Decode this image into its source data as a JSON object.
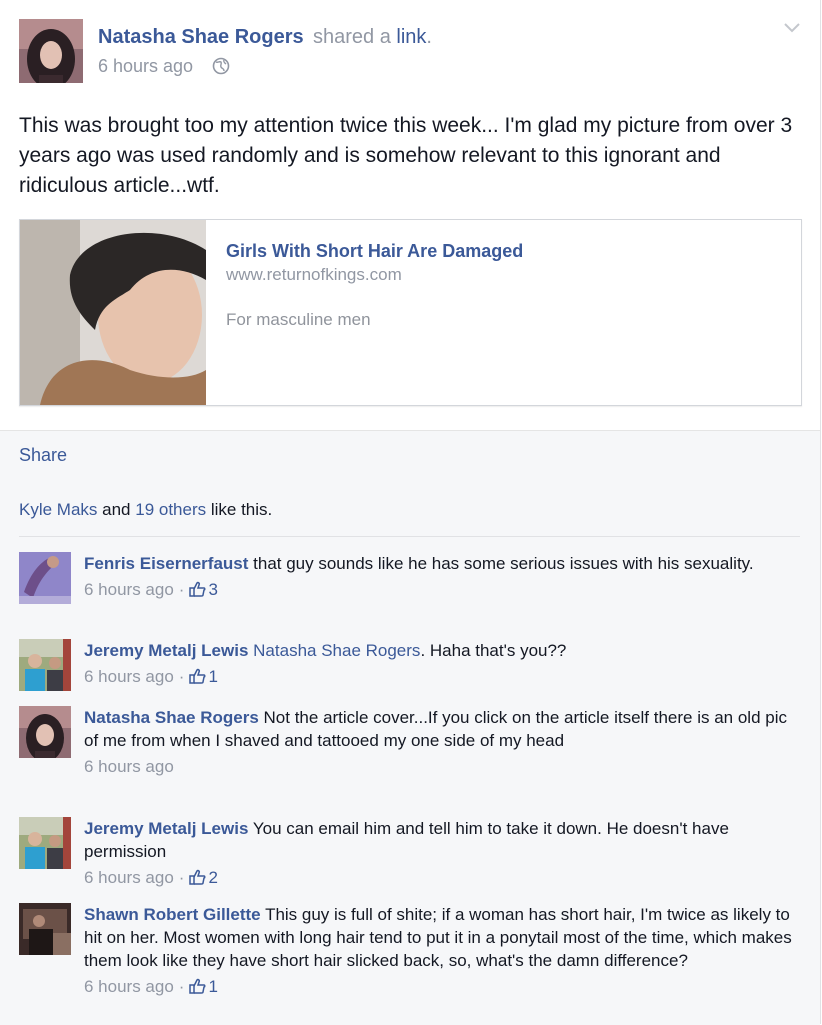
{
  "post": {
    "author": "Natasha Shae Rogers",
    "shared_prefix": "shared a ",
    "shared_link_word": "link",
    "shared_suffix": ".",
    "time": "6 hours ago",
    "text": "This was brought too my attention twice this week... I'm glad my picture from over 3 years ago was used randomly and is somehow relevant to this ignorant and ridiculous article...wtf.",
    "link": {
      "title": "Girls With Short Hair Are Damaged",
      "domain": "www.returnofkings.com",
      "description": "For masculine men"
    }
  },
  "actions": {
    "share": "Share"
  },
  "likes": {
    "first": "Kyle Maks",
    "and": " and ",
    "others": "19 others",
    "suffix": " like this."
  },
  "comments": [
    {
      "author": "Fenris Eisernerfaust",
      "text": "that guy sounds like he has some serious issues with his sexuality.",
      "time": "6 hours ago",
      "likes": "3"
    },
    {
      "author": "Jeremy Metalj Lewis",
      "mention": "Natasha Shae Rogers",
      "text": ". Haha that's you??",
      "time": "6 hours ago",
      "likes": "1"
    },
    {
      "author": "Natasha Shae Rogers",
      "text": "Not the article cover...If you click on the article itself there is an old pic of me from when I shaved and tattooed my one side of my head",
      "time": "6 hours ago"
    },
    {
      "author": "Jeremy Metalj Lewis",
      "text": "You can email him and tell him to take it down. He doesn't have permission",
      "time": "6 hours ago",
      "likes": "2"
    },
    {
      "author": "Shawn Robert Gillette",
      "text": "This guy is full of shite; if a woman has short hair, I'm twice as likely to hit on her. Most women with long hair tend to put it in a ponytail most of the time, which makes them look like they have short hair slicked back, so, what's the damn difference?",
      "time": "6 hours ago",
      "likes": "1"
    }
  ],
  "meta": {
    "dot": "·"
  },
  "colors": {
    "link": "#3b5998",
    "meta": "#9197a3",
    "text": "#141823"
  }
}
